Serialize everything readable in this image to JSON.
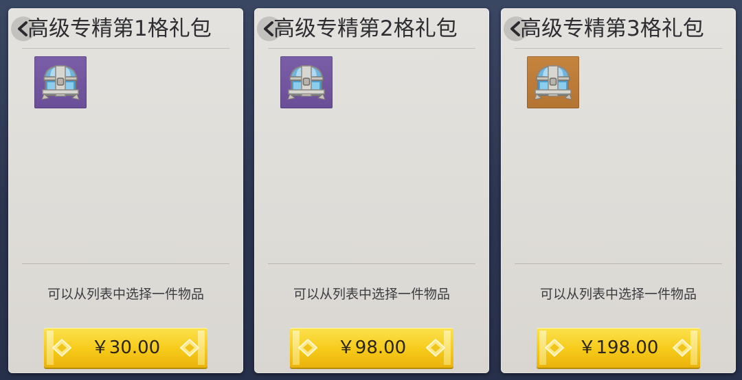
{
  "colors": {
    "background": "#2e3853",
    "card": "#e0ded9",
    "button_yellow": "#f6ca19",
    "slot_purple": "#6e52a0",
    "slot_orange": "#bb7a36"
  },
  "icons": {
    "back": "chevron-left-icon",
    "chest": "treasure-chest-icon",
    "ornament": "diamond-ornament-icon"
  },
  "packs": [
    {
      "title": "高级专精第1格礼包",
      "slot_color": "purple",
      "description": "可以从列表中选择一件物品",
      "price": "￥30.00"
    },
    {
      "title": "高级专精第2格礼包",
      "slot_color": "purple",
      "description": "可以从列表中选择一件物品",
      "price": "￥98.00"
    },
    {
      "title": "高级专精第3格礼包",
      "slot_color": "orange",
      "description": "可以从列表中选择一件物品",
      "price": "￥198.00"
    }
  ]
}
